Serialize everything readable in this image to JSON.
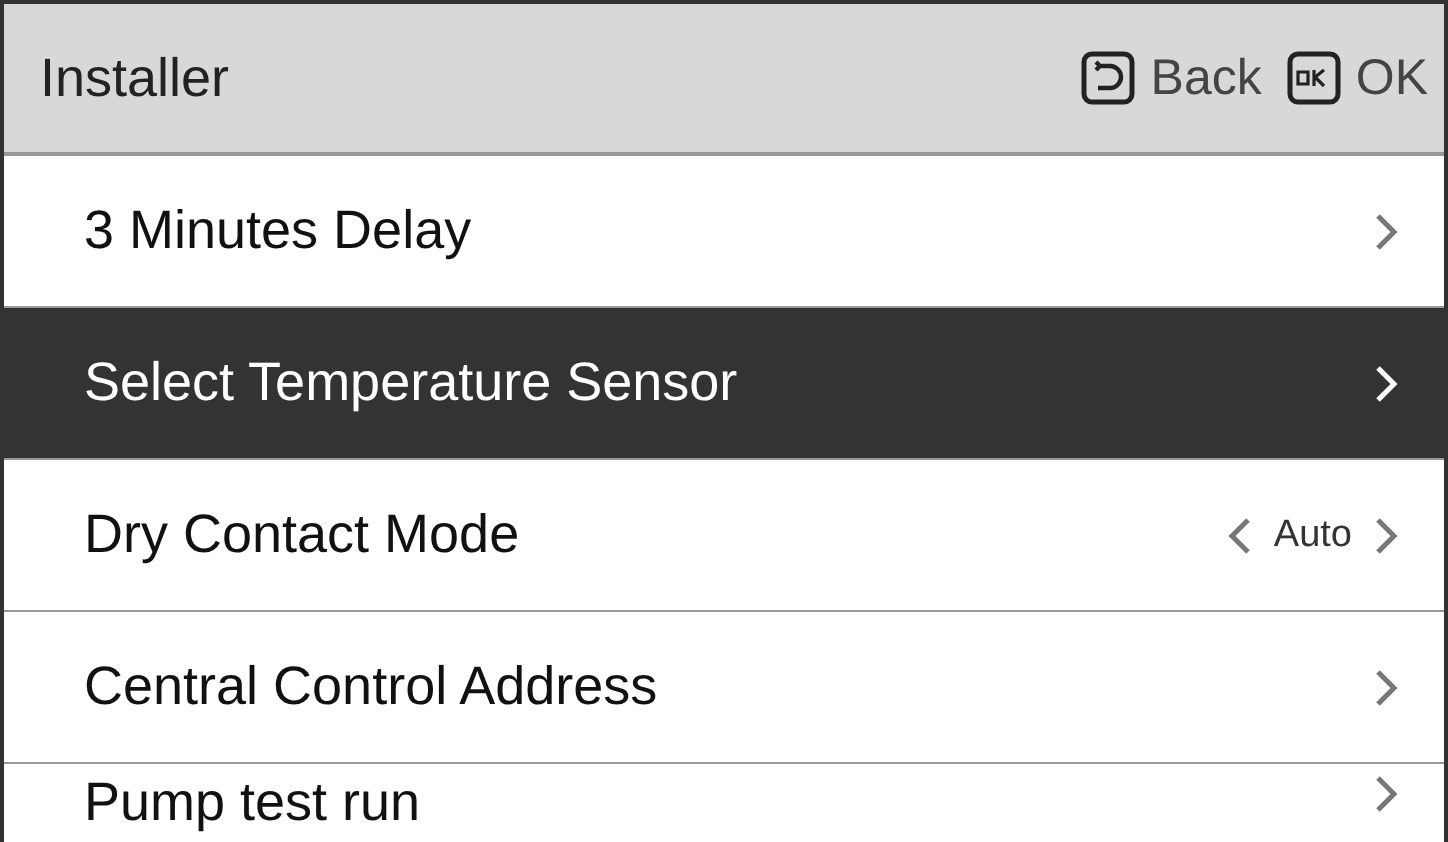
{
  "header": {
    "title": "Installer",
    "actions": [
      {
        "kind": "back",
        "label": "Back"
      },
      {
        "kind": "ok",
        "label": "OK"
      }
    ]
  },
  "menu": [
    {
      "label": "3 Minutes Delay",
      "selected": false,
      "kind": "link"
    },
    {
      "label": "Select Temperature Sensor",
      "selected": true,
      "kind": "link"
    },
    {
      "label": "Dry Contact Mode",
      "selected": false,
      "kind": "option",
      "value": "Auto"
    },
    {
      "label": "Central Control Address",
      "selected": false,
      "kind": "link"
    },
    {
      "label": "Pump test run",
      "selected": false,
      "kind": "link"
    }
  ]
}
